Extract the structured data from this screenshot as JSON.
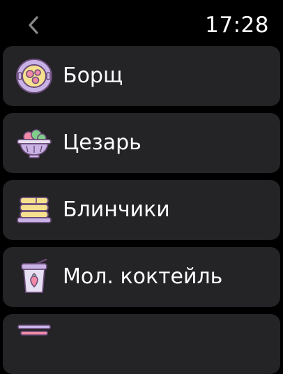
{
  "status_bar": {
    "time": "17:28",
    "back_icon": "chevron-left-icon"
  },
  "colors": {
    "background": "#000000",
    "card": "#242326",
    "text": "#ffffff",
    "icon_outline": "#6b4c7a",
    "icon_purple": "#c9b3e6",
    "icon_pink": "#f28aa7",
    "icon_yellow": "#f5e08e",
    "icon_green": "#7fcf8b",
    "icon_lavender": "#e7e0f3"
  },
  "menu": {
    "items": [
      {
        "label": "Борщ",
        "icon": "soup-bowl-icon"
      },
      {
        "label": "Цезарь",
        "icon": "salad-bowl-icon"
      },
      {
        "label": "Блинчики",
        "icon": "pancakes-icon"
      },
      {
        "label": "Мол. коктейль",
        "icon": "milkshake-icon"
      },
      {
        "label": "",
        "icon": "sushi-chopsticks-icon"
      }
    ]
  }
}
